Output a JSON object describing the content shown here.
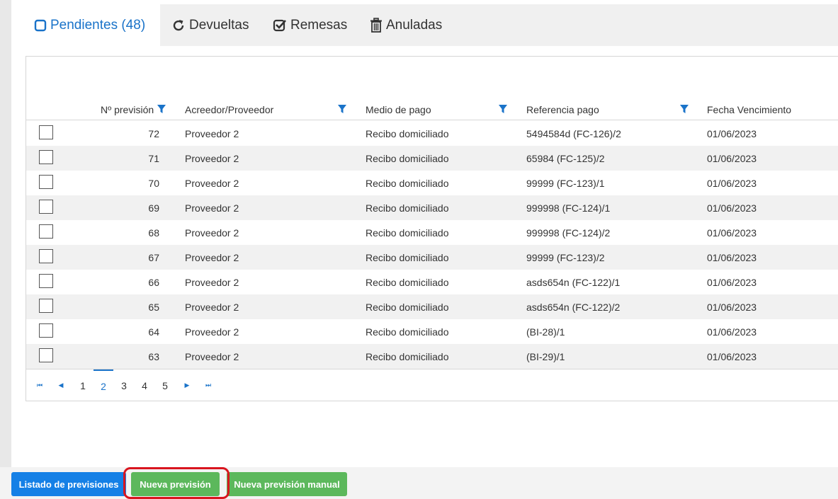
{
  "tabs": [
    {
      "label": "Pendientes (48)",
      "icon": "square-outline-icon",
      "active": true
    },
    {
      "label": "Devueltas",
      "icon": "refresh-icon",
      "active": false
    },
    {
      "label": "Remesas",
      "icon": "checkbox-checked-icon",
      "active": false
    },
    {
      "label": "Anuladas",
      "icon": "trash-icon",
      "active": false
    }
  ],
  "grid": {
    "columns": [
      "Nº previsión",
      "Acreedor/Proveedor",
      "Medio de pago",
      "Referencia pago",
      "Fecha Vencimiento"
    ],
    "rows": [
      {
        "num": "72",
        "acreedor": "Proveedor 2",
        "medio": "Recibo domiciliado",
        "referencia": "5494584d (FC-126)/2",
        "fecha": "01/06/2023"
      },
      {
        "num": "71",
        "acreedor": "Proveedor 2",
        "medio": "Recibo domiciliado",
        "referencia": "65984 (FC-125)/2",
        "fecha": "01/06/2023"
      },
      {
        "num": "70",
        "acreedor": "Proveedor 2",
        "medio": "Recibo domiciliado",
        "referencia": "99999 (FC-123)/1",
        "fecha": "01/06/2023"
      },
      {
        "num": "69",
        "acreedor": "Proveedor 2",
        "medio": "Recibo domiciliado",
        "referencia": "999998 (FC-124)/1",
        "fecha": "01/06/2023"
      },
      {
        "num": "68",
        "acreedor": "Proveedor 2",
        "medio": "Recibo domiciliado",
        "referencia": "999998 (FC-124)/2",
        "fecha": "01/06/2023"
      },
      {
        "num": "67",
        "acreedor": "Proveedor 2",
        "medio": "Recibo domiciliado",
        "referencia": "99999 (FC-123)/2",
        "fecha": "01/06/2023"
      },
      {
        "num": "66",
        "acreedor": "Proveedor 2",
        "medio": "Recibo domiciliado",
        "referencia": "asds654n (FC-122)/1",
        "fecha": "01/06/2023"
      },
      {
        "num": "65",
        "acreedor": "Proveedor 2",
        "medio": "Recibo domiciliado",
        "referencia": "asds654n (FC-122)/2",
        "fecha": "01/06/2023"
      },
      {
        "num": "64",
        "acreedor": "Proveedor 2",
        "medio": "Recibo domiciliado",
        "referencia": "(BI-28)/1",
        "fecha": "01/06/2023"
      },
      {
        "num": "63",
        "acreedor": "Proveedor 2",
        "medio": "Recibo domiciliado",
        "referencia": "(BI-29)/1",
        "fecha": "01/06/2023"
      }
    ]
  },
  "pager": {
    "first": "⏮",
    "prev": "◀",
    "next": "▶",
    "last": "⏭",
    "pages": [
      "1",
      "2",
      "3",
      "4",
      "5"
    ],
    "current": "2"
  },
  "footer": {
    "listado_label": "Listado de previsiones",
    "nueva_label": "Nueva previsión",
    "manual_label": "Nueva previsión manual"
  },
  "colors": {
    "accent": "#1a73c9",
    "blue_button": "#1580e6",
    "green_button": "#5cb85c",
    "highlight": "#d9151f"
  }
}
